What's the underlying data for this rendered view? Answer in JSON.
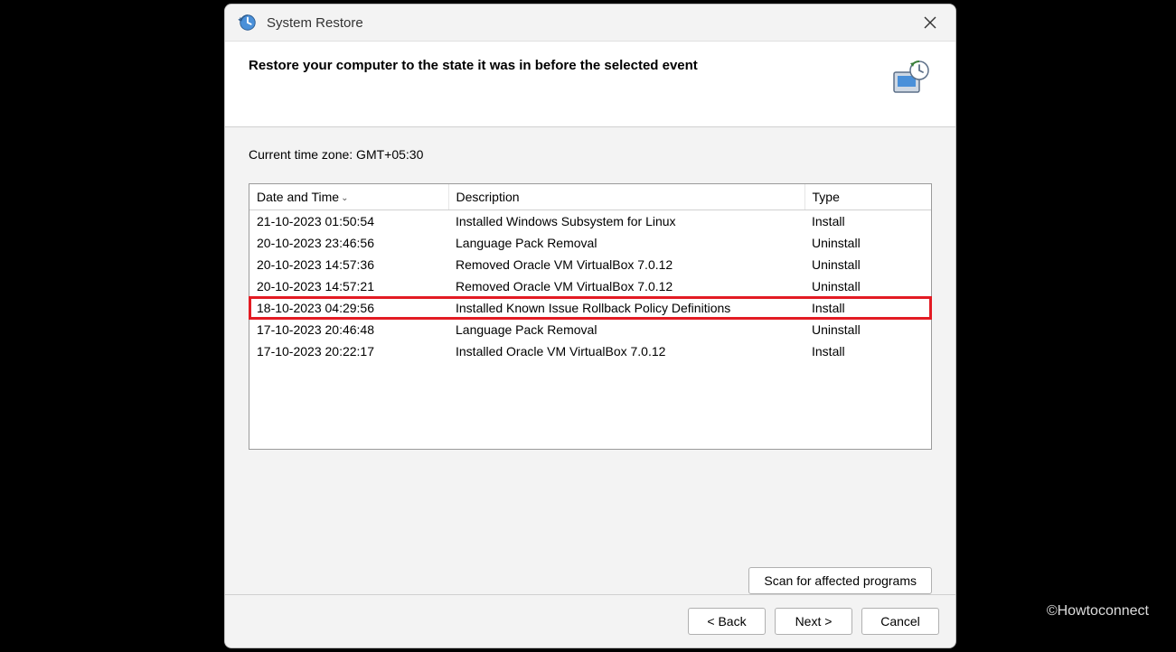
{
  "window": {
    "title": "System Restore",
    "heading": "Restore your computer to the state it was in before the selected event"
  },
  "timezone_label": "Current time zone: GMT+05:30",
  "table": {
    "headers": {
      "datetime": "Date and Time",
      "description": "Description",
      "type": "Type"
    },
    "sort_indicator": "⌄",
    "rows": [
      {
        "datetime": "21-10-2023 01:50:54",
        "description": "Installed Windows Subsystem for Linux",
        "type": "Install",
        "highlight": false
      },
      {
        "datetime": "20-10-2023 23:46:56",
        "description": "Language Pack Removal",
        "type": "Uninstall",
        "highlight": false
      },
      {
        "datetime": "20-10-2023 14:57:36",
        "description": "Removed Oracle VM VirtualBox 7.0.12",
        "type": "Uninstall",
        "highlight": false
      },
      {
        "datetime": "20-10-2023 14:57:21",
        "description": "Removed Oracle VM VirtualBox 7.0.12",
        "type": "Uninstall",
        "highlight": false
      },
      {
        "datetime": "18-10-2023 04:29:56",
        "description": "Installed Known Issue Rollback Policy Definitions",
        "type": "Install",
        "highlight": true
      },
      {
        "datetime": "17-10-2023 20:46:48",
        "description": "Language Pack Removal",
        "type": "Uninstall",
        "highlight": false
      },
      {
        "datetime": "17-10-2023 20:22:17",
        "description": "Installed Oracle VM VirtualBox 7.0.12",
        "type": "Install",
        "highlight": false
      }
    ],
    "empty_rows": 4
  },
  "buttons": {
    "scan": "Scan for affected programs",
    "back": "< Back",
    "next": "Next >",
    "cancel": "Cancel"
  },
  "watermark": "©Howtoconnect"
}
